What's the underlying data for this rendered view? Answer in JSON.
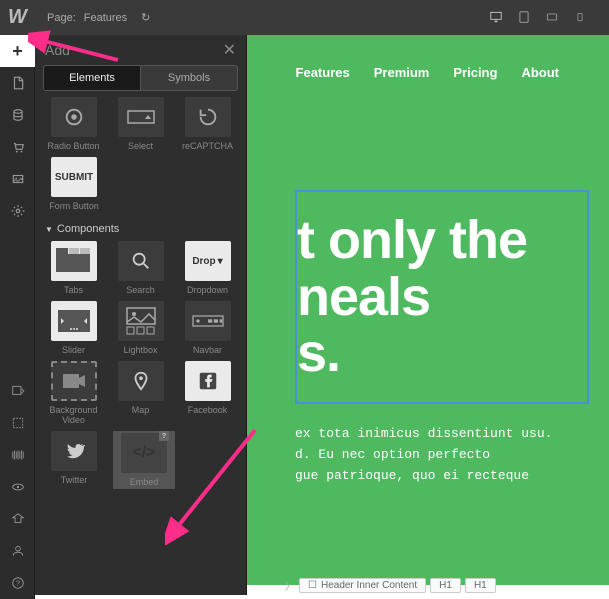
{
  "topbar": {
    "page_label": "Page:",
    "page_name": "Features"
  },
  "devices": [
    "desktop",
    "tablet",
    "tablet-l",
    "mobile"
  ],
  "rail": {
    "top": [
      "add",
      "page",
      "cms",
      "store",
      "assets",
      "settings"
    ],
    "bottom": [
      "navigator",
      "selection",
      "audit",
      "preview",
      "publish",
      "account",
      "help"
    ]
  },
  "panel": {
    "title": "Add",
    "tabs": {
      "elements": "Elements",
      "symbols": "Symbols"
    },
    "section_components": "Components",
    "items": {
      "radio": "Radio Button",
      "select": "Select",
      "recaptcha": "reCAPTCHA",
      "submit_btn": "SUBMIT",
      "form_button": "Form Button",
      "tabs": "Tabs",
      "search": "Search",
      "dropdown": "Dropdown",
      "drop_btn": "Drop",
      "slider": "Slider",
      "lightbox": "Lightbox",
      "navbar": "Navbar",
      "bgvideo": "Background Video",
      "map": "Map",
      "facebook": "Facebook",
      "twitter": "Twitter",
      "embed": "Embed"
    }
  },
  "nav": {
    "features": "Features",
    "premium": "Premium",
    "pricing": "Pricing",
    "about": "About"
  },
  "hero": {
    "line1": "t only the",
    "line2": "neals",
    "line3": "s."
  },
  "body": {
    "l1": "ex tota inimicus dissentiunt usu.",
    "l2": "d. Eu nec option perfecto",
    "l3": "gue patrioque, quo ei recteque"
  },
  "breadcrumb": {
    "item": "Header Inner Content",
    "h1a": "H1",
    "h1b": "H1"
  }
}
